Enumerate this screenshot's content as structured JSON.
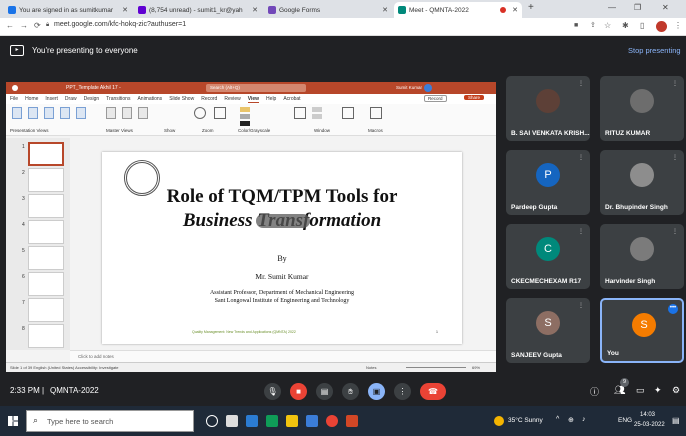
{
  "tabs": [
    {
      "title": "You are signed in as sumitkumar",
      "fav_color": "#1a73e8"
    },
    {
      "title": "(8,754 unread) - sumit1_kr@yah",
      "fav_color": "#6001d2"
    },
    {
      "title": "Google Forms",
      "fav_color": "#7248b9"
    },
    {
      "title": "Meet - QMNTA-2022",
      "fav_color": "#00897b"
    }
  ],
  "address": {
    "url": "meet.google.com/kfc-hokq-zic?authuser=1"
  },
  "presenting": {
    "text": "You're presenting to everyone",
    "stop_label": "Stop presenting"
  },
  "ppt": {
    "file": "PPT_Template Akhil 17 -",
    "search": "Search (Alt+Q)",
    "user": "Sumit Kumar",
    "menu": [
      "File",
      "Home",
      "Insert",
      "Draw",
      "Design",
      "Transitions",
      "Animations",
      "Slide Show",
      "Record",
      "Review",
      "View",
      "Help",
      "Acrobat"
    ],
    "record_label": "Record",
    "share_label": "Share",
    "ribbon_groups": [
      "Presentation Views",
      "Master Views",
      "Show",
      "Zoom",
      "Color/Grayscale",
      "Window",
      "Macros"
    ],
    "slide_title_1": "Role of TQM/TPM Tools for",
    "slide_title_2": "Business Transformation",
    "slide_by": "By",
    "slide_author": "Mr. Sumit Kumar",
    "slide_aff1": "Assistant Professor, Department of Mechanical Engineering",
    "slide_aff2": "Sant Longowal Institute of Engineering and Technology",
    "slide_footer": "Quality Management: New Trends and Applications (QMNTA) 2022",
    "slide_page": "1",
    "notes_placeholder": "Click to add notes",
    "status": "Slide 1 of 39   English (United States)   Accessibility: Investigate",
    "status_notes": "Notes",
    "zoom": "69%",
    "thumb_numbers": [
      "1",
      "2",
      "3",
      "4",
      "5",
      "6",
      "7",
      "8"
    ]
  },
  "participants": [
    {
      "name": "B. SAI VENKATA KRISH...",
      "initial": "",
      "color": "#5d4037"
    },
    {
      "name": "RITUZ KUMAR",
      "initial": "",
      "color": "#6d6d6d"
    },
    {
      "name": "Pardeep Gupta",
      "initial": "P",
      "color": "#1565c0"
    },
    {
      "name": "Dr. Bhupinder Singh",
      "initial": "",
      "color": "#8d8d8d"
    },
    {
      "name": "CKECMECHEXAM R17",
      "initial": "C",
      "color": "#00897b"
    },
    {
      "name": "Harvinder Singh",
      "initial": "",
      "color": "#7b7b7b"
    },
    {
      "name": "SANJEEV Gupta",
      "initial": "S",
      "color": "#8d6e63"
    },
    {
      "name": "You",
      "initial": "S",
      "color": "#f57c00"
    }
  ],
  "meeting": {
    "time": "2:33 PM",
    "sep": "|",
    "code": "QMNTA-2022",
    "people_count": "9"
  },
  "taskbar": {
    "search_placeholder": "Type here to search",
    "weather": "35°C Sunny",
    "lang": "ENG",
    "time": "14:03",
    "date": "25-03-2022"
  }
}
